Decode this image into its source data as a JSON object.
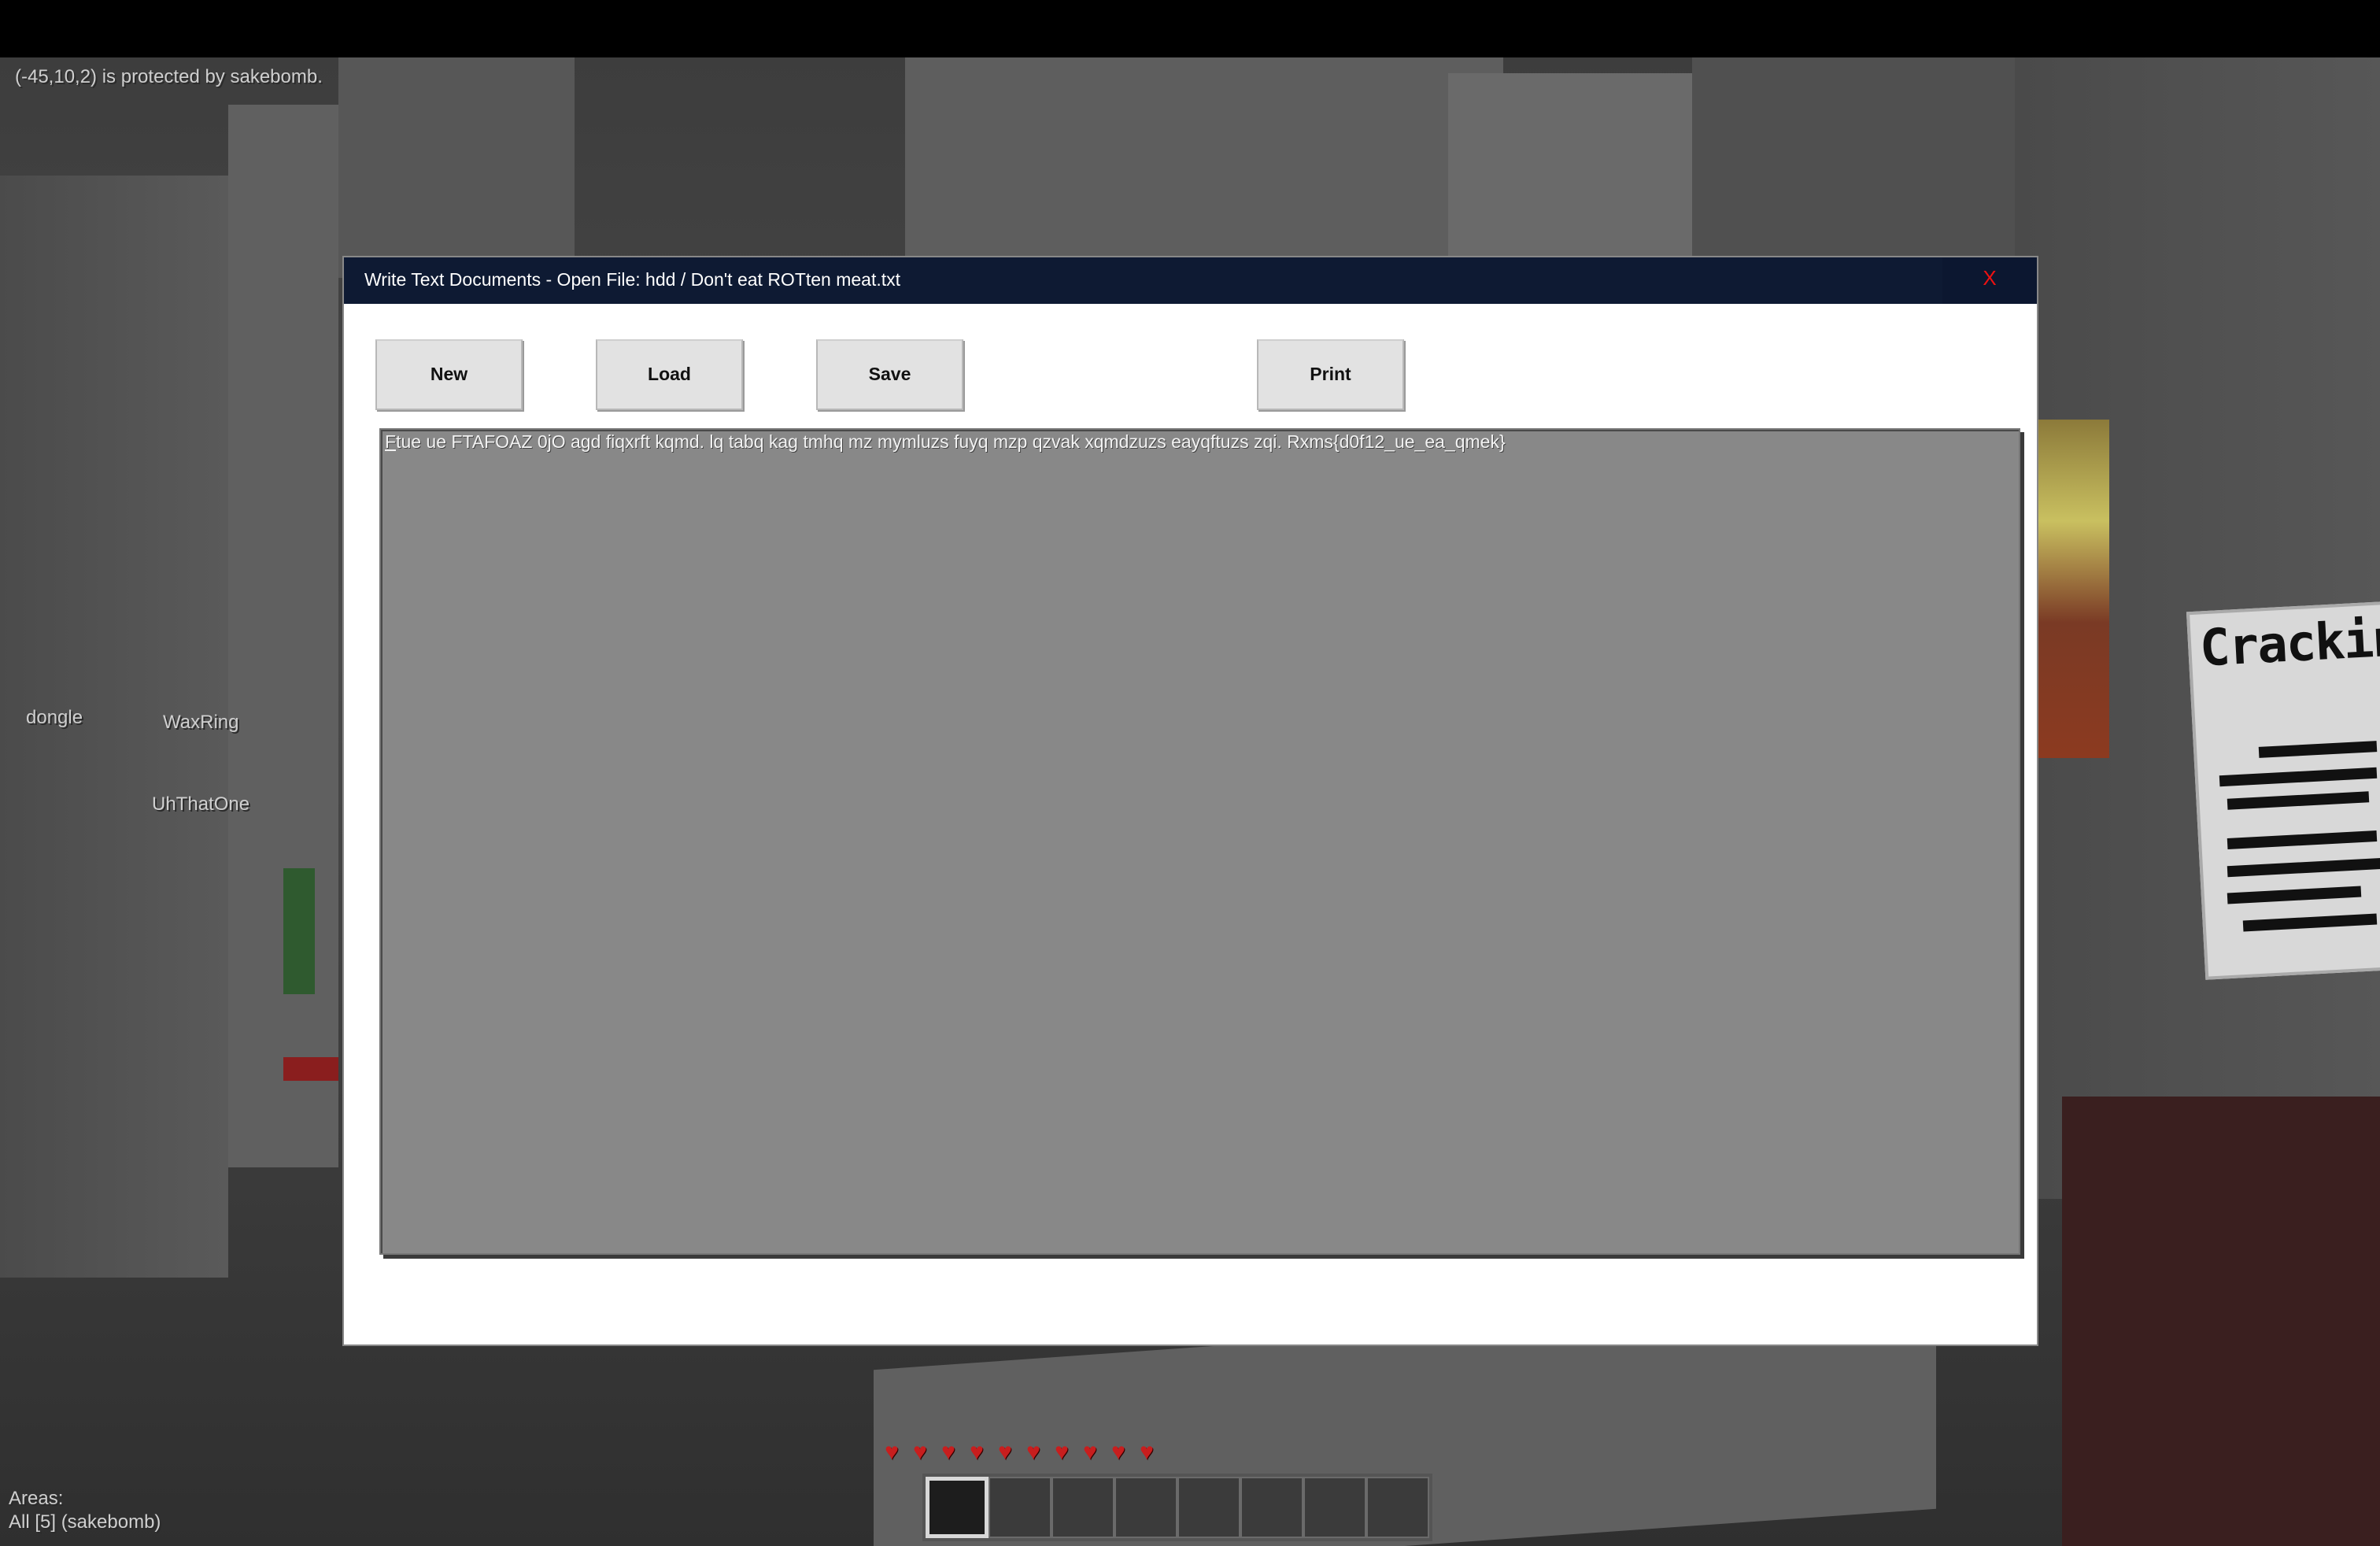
{
  "hud": {
    "protection_message": "(-45,10,2) is protected by sakebomb.",
    "areas_label": "Areas:",
    "areas_value": "All [5] (sakebomb)",
    "player_names": [
      "dongle",
      "WaxRing",
      "UhThatOne"
    ],
    "health_hearts": 10,
    "hotbar_slots": 8,
    "selected_slot": 1
  },
  "world": {
    "sign_text": "Cracking"
  },
  "dialog": {
    "title": "Write Text Documents - Open File: hdd / Don't eat ROTten meat.txt",
    "close_label": "X",
    "buttons": {
      "new": "New",
      "load": "Load",
      "save": "Save",
      "print": "Print"
    },
    "document_text": "Ftue ue FTAFOAZ 0jO agd fiqxrft kqmd. lq tabq kag tmhq mz mymluzs fuyq mzp qzvak xqmdzuzs eayqftuzs zqi. Rxms{d0f12_ue_ea_qmek}"
  },
  "colors": {
    "titlebar": "#0e1a33",
    "close": "#ee1111",
    "heart": "#c81e1e",
    "text_area": "#888888"
  }
}
